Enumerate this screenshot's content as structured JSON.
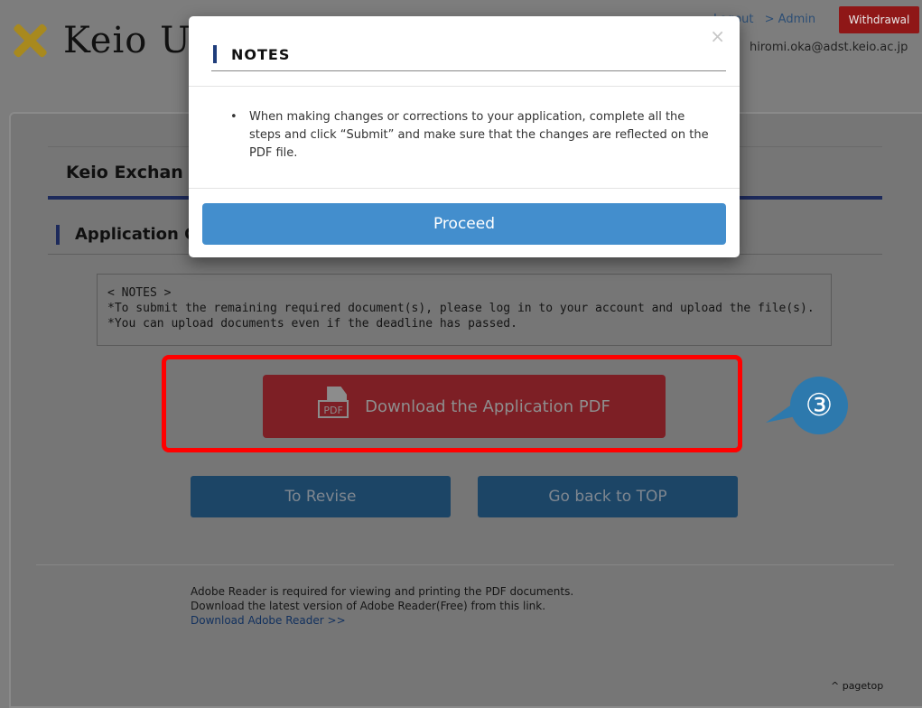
{
  "header": {
    "logo_text": "Keio U",
    "logout": "Logout",
    "admin": "> Admin",
    "withdrawal": "Withdrawal",
    "email": "hiromi.oka@adst.keio.ac.jp"
  },
  "page": {
    "title": "Keio Exchan",
    "section_title": "Application C",
    "notes": {
      "heading": "< NOTES >",
      "line1": "*To submit the remaining required document(s), please log in to your account and upload the file(s).",
      "line2": "*You can upload documents even if the deadline has passed."
    },
    "pdf_button": "Download the Application PDF",
    "pdf_icon_text": "PDF",
    "step_badge": "③",
    "revise_button": "To Revise",
    "top_button": "Go back to TOP",
    "footer": {
      "line1": "Adobe Reader is required for viewing and printing the PDF documents.",
      "line2": "Download the latest version of Adobe Reader(Free) from this link.",
      "link": "Download Adobe Reader >>"
    },
    "pagetop": "^ pagetop"
  },
  "modal": {
    "title": "NOTES",
    "close": "×",
    "bullet": "•",
    "body": "When making changes or corrections to your application, complete all the steps and click “Submit” and make sure that the changes are reflected on the PDF file.",
    "proceed": "Proceed"
  },
  "colors": {
    "overlay": "#7d7d7d",
    "withdrawal": "#8f1717",
    "pdf_button": "#7d1f25",
    "highlight": "#ff0000",
    "step_badge": "#2d79ad",
    "secondary_button": "#1c4566",
    "proceed": "#438ecd"
  }
}
